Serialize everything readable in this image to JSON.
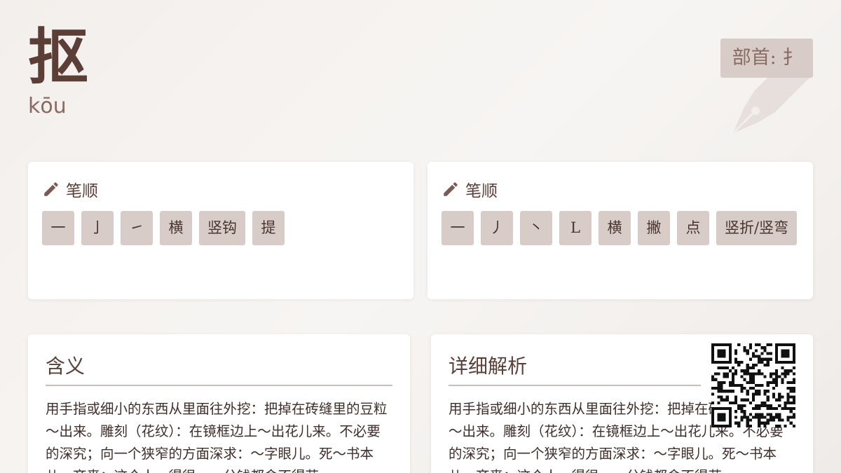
{
  "header": {
    "character": "抠",
    "pinyin": "kōu",
    "radical": "部首: 扌"
  },
  "stroke_cards": [
    {
      "title": "笔顺",
      "strokes": [
        "一",
        "亅",
        "㇀",
        "横",
        "竖钩",
        "提"
      ]
    },
    {
      "title": "笔顺",
      "strokes": [
        "一",
        "丿",
        "丶",
        "L",
        "横",
        "撇",
        "点",
        "竖折/竖弯"
      ]
    }
  ],
  "meaning": {
    "title": "含义",
    "text": "用手指或细小的东西从里面往外挖：把掉在砖缝里的豆粒～出来。雕刻（花纹）：在镜框边上～出花儿来。不必要的深究；向一个狭窄的方面深求：～字眼儿。死～书本儿。吝啬：这个人～得很，一分钱都舍不得花。"
  },
  "detail": {
    "title": "详细解析",
    "text": "用手指或细小的东西从里面往外挖：把掉在砖缝里的豆粒～出来。雕刻（花纹）：在镜框边上～出花儿来。不必要的深究；向一个狭窄的方面深求：～字眼儿。死～书本儿。吝啬：这个人～得很，一分钱都舍不得花。"
  },
  "colors": {
    "accent": "#5b3f37",
    "tile": "#d8ccc9",
    "card": "#ffffff"
  }
}
